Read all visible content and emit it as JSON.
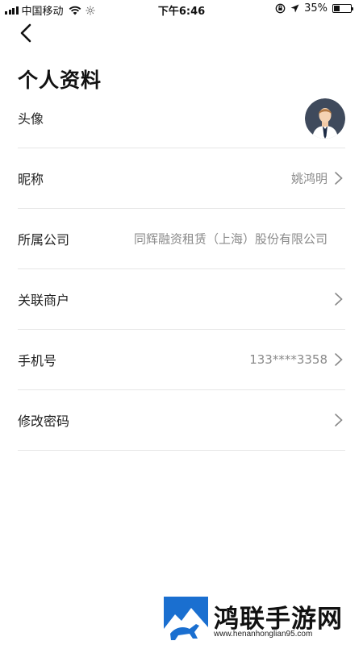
{
  "status_bar": {
    "carrier": "中国移动",
    "time": "下午6:46",
    "battery": "35%",
    "battery_level": 0.35
  },
  "header": {
    "title": "个人资料",
    "back_icon": "chevron-left-icon"
  },
  "rows": [
    {
      "label": "头像",
      "type": "avatar"
    },
    {
      "label": "昵称",
      "value": "姚鸿明",
      "chevron": true
    },
    {
      "label": "所属公司",
      "value": "同辉融资租赁（上海）股份有限公司",
      "chevron": false
    },
    {
      "label": "关联商户",
      "value": "",
      "chevron": true
    },
    {
      "label": "手机号",
      "value": "133****3358",
      "chevron": true
    },
    {
      "label": "修改密码",
      "value": "",
      "chevron": true
    }
  ],
  "watermark": {
    "name": "鸿联手游网",
    "url": "www.henanhonglian95.com"
  },
  "colors": {
    "divider": "#e6e6e6",
    "value_text": "#8a8a8a",
    "avatar_bg": "#3f4a5c"
  }
}
